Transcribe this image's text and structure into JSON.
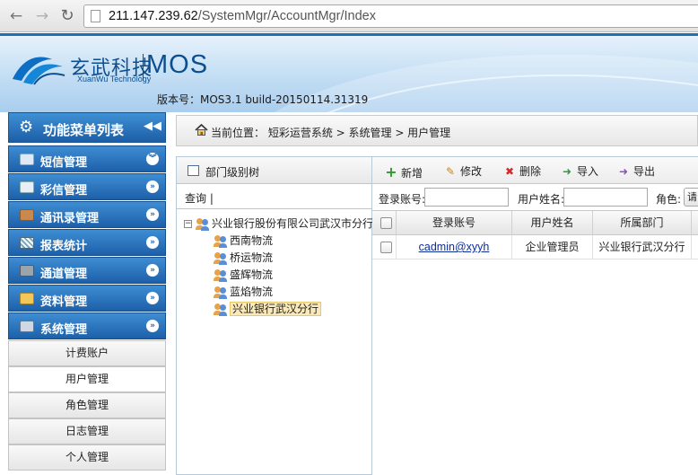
{
  "browser": {
    "url_host": "211.147.239.62",
    "url_path": "/SystemMgr/AccountMgr/Index"
  },
  "header": {
    "logo_cn": "玄武科技",
    "logo_en": "XuanWu Technology",
    "product": "MOS",
    "version": "版本号：MOS3.1 build-20150114.31319"
  },
  "colors": {
    "header_accent": "#1f6fb5",
    "menu_blue": "#1d60a9",
    "selected_node": "#fbeab8",
    "add_green": "#2a9a2a",
    "delete_red": "#d22b2b",
    "link_blue": "#0b2e9c"
  },
  "sidebar": {
    "title": "功能菜单列表",
    "icons": {
      "title": "gear-icon",
      "collapse": "double-chevron-left-icon",
      "expand": "chevron-circle-icon"
    },
    "menus": [
      {
        "label": "短信管理",
        "icon": "sms-icon",
        "arrow": "︾"
      },
      {
        "label": "彩信管理",
        "icon": "mms-icon",
        "arrow": "»"
      },
      {
        "label": "通讯录管理",
        "icon": "contacts-icon",
        "arrow": "»"
      },
      {
        "label": "报表统计",
        "icon": "report-icon",
        "arrow": "»"
      },
      {
        "label": "通道管理",
        "icon": "channel-icon",
        "arrow": "»"
      },
      {
        "label": "资料管理",
        "icon": "folder-icon",
        "arrow": "»"
      },
      {
        "label": "系统管理",
        "icon": "system-icon",
        "arrow": "»"
      }
    ],
    "sub_items": [
      {
        "label": "计费账户"
      },
      {
        "label": "用户管理"
      },
      {
        "label": "角色管理"
      },
      {
        "label": "日志管理"
      },
      {
        "label": "个人管理"
      }
    ]
  },
  "breadcrumb": {
    "text": "当前位置： 短彩运营系统 > 系统管理 > 用户管理"
  },
  "tree": {
    "title": "部门级别树",
    "search_label": "查询 |",
    "root": "兴业银行股份有限公司武汉市分行",
    "root_expander": "−",
    "children": [
      "西南物流",
      "桥运物流",
      "盛辉物流",
      "蓝焰物流",
      "兴业银行武汉分行"
    ],
    "selected": "兴业银行武汉分行"
  },
  "toolbar": {
    "add": "新增",
    "edit": "修改",
    "delete": "删除",
    "import": "导入",
    "export": "导出",
    "icons": {
      "add": "+",
      "edit": "✎",
      "delete": "✖",
      "import": "➜",
      "export": "➜"
    }
  },
  "filters": {
    "account_label": "登录账号:",
    "account_value": "",
    "name_label": "用户姓名:",
    "name_value": "",
    "role_label": "角色:",
    "role_value": "请"
  },
  "grid": {
    "columns": [
      "登录账号",
      "用户姓名",
      "所属部门"
    ],
    "rows": [
      {
        "account": "cadmin@xyyh",
        "name": "企业管理员",
        "dept": "兴业银行武汉分行"
      }
    ]
  }
}
